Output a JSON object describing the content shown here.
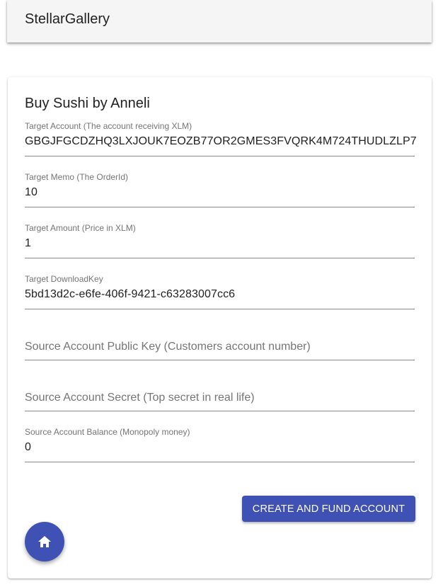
{
  "appbar": {
    "title": "StellarGallery"
  },
  "card": {
    "title": "Buy Sushi by Anneli"
  },
  "fields": [
    {
      "label": "Target Account (The account receiving XLM)",
      "value": "GBGJFGCDZHQ3LXJOUK7EOZB77OR2GMES3FVQRK4M724THUDLZLP7"
    },
    {
      "label": "Target Memo (The OrderId)",
      "value": "10"
    },
    {
      "label": "Target Amount (Price in XLM)",
      "value": "1"
    },
    {
      "label": "Target DownloadKey",
      "value": "5bd13d2c-e6fe-406f-9421-c63283007cc6"
    },
    {
      "placeholder": "Source Account Public Key (Customers account number)"
    },
    {
      "placeholder": "Source Account Secret (Top secret in real life)"
    },
    {
      "label": "Source Account Balance (Monopoly money)",
      "value": "0"
    }
  ],
  "actions": {
    "create_label": "CREATE AND FUND ACCOUNT"
  },
  "colors": {
    "primary": "#3f51b5"
  }
}
